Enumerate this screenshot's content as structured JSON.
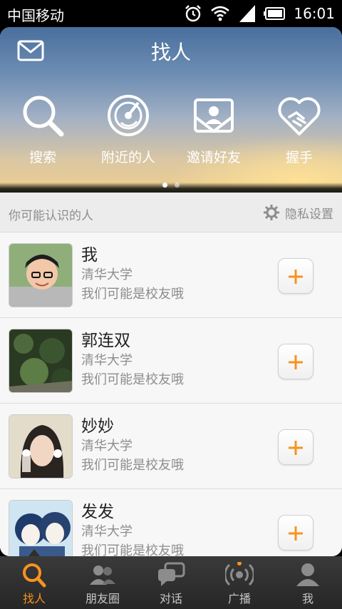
{
  "status_bar": {
    "carrier": "中国移动",
    "time": "16:01",
    "icons": [
      "alarm-icon",
      "wifi-icon",
      "signal-icon",
      "battery-icon"
    ]
  },
  "header": {
    "title": "找人",
    "mail_icon": "mail-icon"
  },
  "features": [
    {
      "label": "搜索",
      "icon": "search-icon"
    },
    {
      "label": "附近的人",
      "icon": "radar-icon"
    },
    {
      "label": "邀请好友",
      "icon": "invite-icon"
    },
    {
      "label": "握手",
      "icon": "handshake-icon"
    }
  ],
  "carousel": {
    "pages": 2,
    "active": 1
  },
  "section": {
    "title": "你可能认识的人",
    "privacy_label": "隐私设置",
    "privacy_icon": "gear-icon"
  },
  "people": [
    {
      "name": "我",
      "school": "清华大学",
      "reason": "我们可能是校友哦"
    },
    {
      "name": "郭连双",
      "school": "清华大学",
      "reason": "我们可能是校友哦"
    },
    {
      "name": "妙妙",
      "school": "清华大学",
      "reason": "我们可能是校友哦"
    },
    {
      "name": "发发",
      "school": "清华大学",
      "reason": "我们可能是校友哦"
    }
  ],
  "nav": [
    {
      "label": "找人",
      "icon": "search-icon",
      "active": true
    },
    {
      "label": "朋友圈",
      "icon": "people-icon",
      "active": false
    },
    {
      "label": "对话",
      "icon": "chat-icon",
      "active": false
    },
    {
      "label": "广播",
      "icon": "broadcast-icon",
      "active": false
    },
    {
      "label": "我",
      "icon": "person-icon",
      "active": false
    }
  ],
  "colors": {
    "accent": "#f7931e",
    "nav_bg": "#2e2e2e",
    "muted_text": "#8d8d8d"
  }
}
